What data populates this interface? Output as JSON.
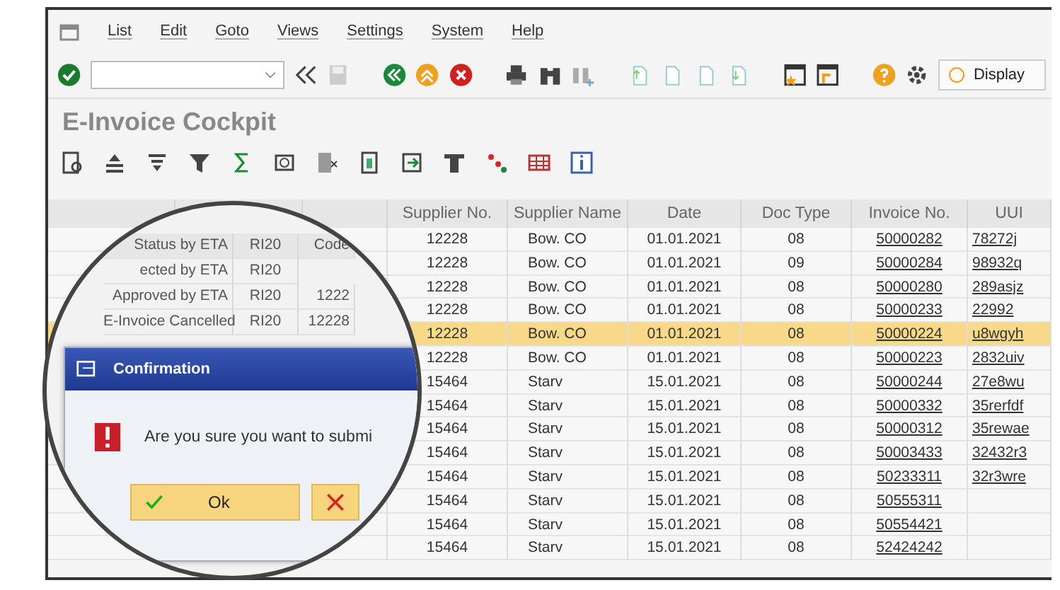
{
  "menu": [
    "List",
    "Edit",
    "Goto",
    "Views",
    "Settings",
    "System",
    "Help"
  ],
  "toolbar": {
    "display_button": "Display"
  },
  "title": "E-Invoice Cockpit",
  "table": {
    "columns": [
      "Supplier No.",
      "Supplier Name",
      "Date",
      "Doc Type",
      "Invoice No.",
      "UUI"
    ],
    "rows": [
      {
        "cells": [
          "12228",
          "Bow. CO",
          "01.01.2021",
          "08",
          "50000282",
          "78272j"
        ],
        "selected": false
      },
      {
        "cells": [
          "12228",
          "Bow. CO",
          "01.01.2021",
          "09",
          "50000284",
          "98932q"
        ],
        "selected": false
      },
      {
        "cells": [
          "12228",
          "Bow. CO",
          "01.01.2021",
          "08",
          "50000280",
          "289asjz"
        ],
        "selected": false
      },
      {
        "cells": [
          "12228",
          "Bow. CO",
          "01.01.2021",
          "08",
          "50000233",
          "22992"
        ],
        "selected": false
      },
      {
        "cells": [
          "12228",
          "Bow. CO",
          "01.01.2021",
          "08",
          "50000224",
          "u8wgyh"
        ],
        "selected": true
      },
      {
        "cells": [
          "12228",
          "Bow. CO",
          "01.01.2021",
          "08",
          "50000223",
          "2832uiv"
        ],
        "selected": false
      },
      {
        "cells": [
          "15464",
          "Starv",
          "15.01.2021",
          "08",
          "50000244",
          "27e8wu"
        ],
        "selected": false
      },
      {
        "cells": [
          "15464",
          "Starv",
          "15.01.2021",
          "08",
          "50000332",
          "35rerfdf"
        ],
        "selected": false
      },
      {
        "cells": [
          "15464",
          "Starv",
          "15.01.2021",
          "08",
          "50000312",
          "35rewae"
        ],
        "selected": false
      },
      {
        "cells": [
          "15464",
          "Starv",
          "15.01.2021",
          "08",
          "50003433",
          "32432r3"
        ],
        "selected": false
      },
      {
        "cells": [
          "15464",
          "Starv",
          "15.01.2021",
          "08",
          "50233311",
          "32r3wre"
        ],
        "selected": false
      },
      {
        "cells": [
          "15464",
          "Starv",
          "15.01.2021",
          "08",
          "50555311"
        ],
        "selected": false
      },
      {
        "cells": [
          "15464",
          "Starv",
          "15.01.2021",
          "08",
          "50554421"
        ],
        "selected": false
      },
      {
        "cells": [
          "15464",
          "Starv",
          "15.01.2021",
          "08",
          "52424242"
        ],
        "selected": false
      }
    ]
  },
  "magnifier": {
    "header": [
      "Status by ETA",
      "RI20",
      "Code"
    ],
    "rows": [
      {
        "cells": [
          "ected by ETA",
          "RI20"
        ]
      },
      {
        "cells": [
          "Approved by ETA",
          "RI20",
          "1222"
        ]
      },
      {
        "cells": [
          "E-Invoice Cancelled",
          "RI20",
          "12228"
        ]
      }
    ],
    "dialog": {
      "title": "Confirmation",
      "message": "Are you sure you want to submi",
      "buttons": [
        {
          "kind": "ok",
          "label": "Ok"
        },
        {
          "kind": "cancel"
        }
      ]
    }
  }
}
